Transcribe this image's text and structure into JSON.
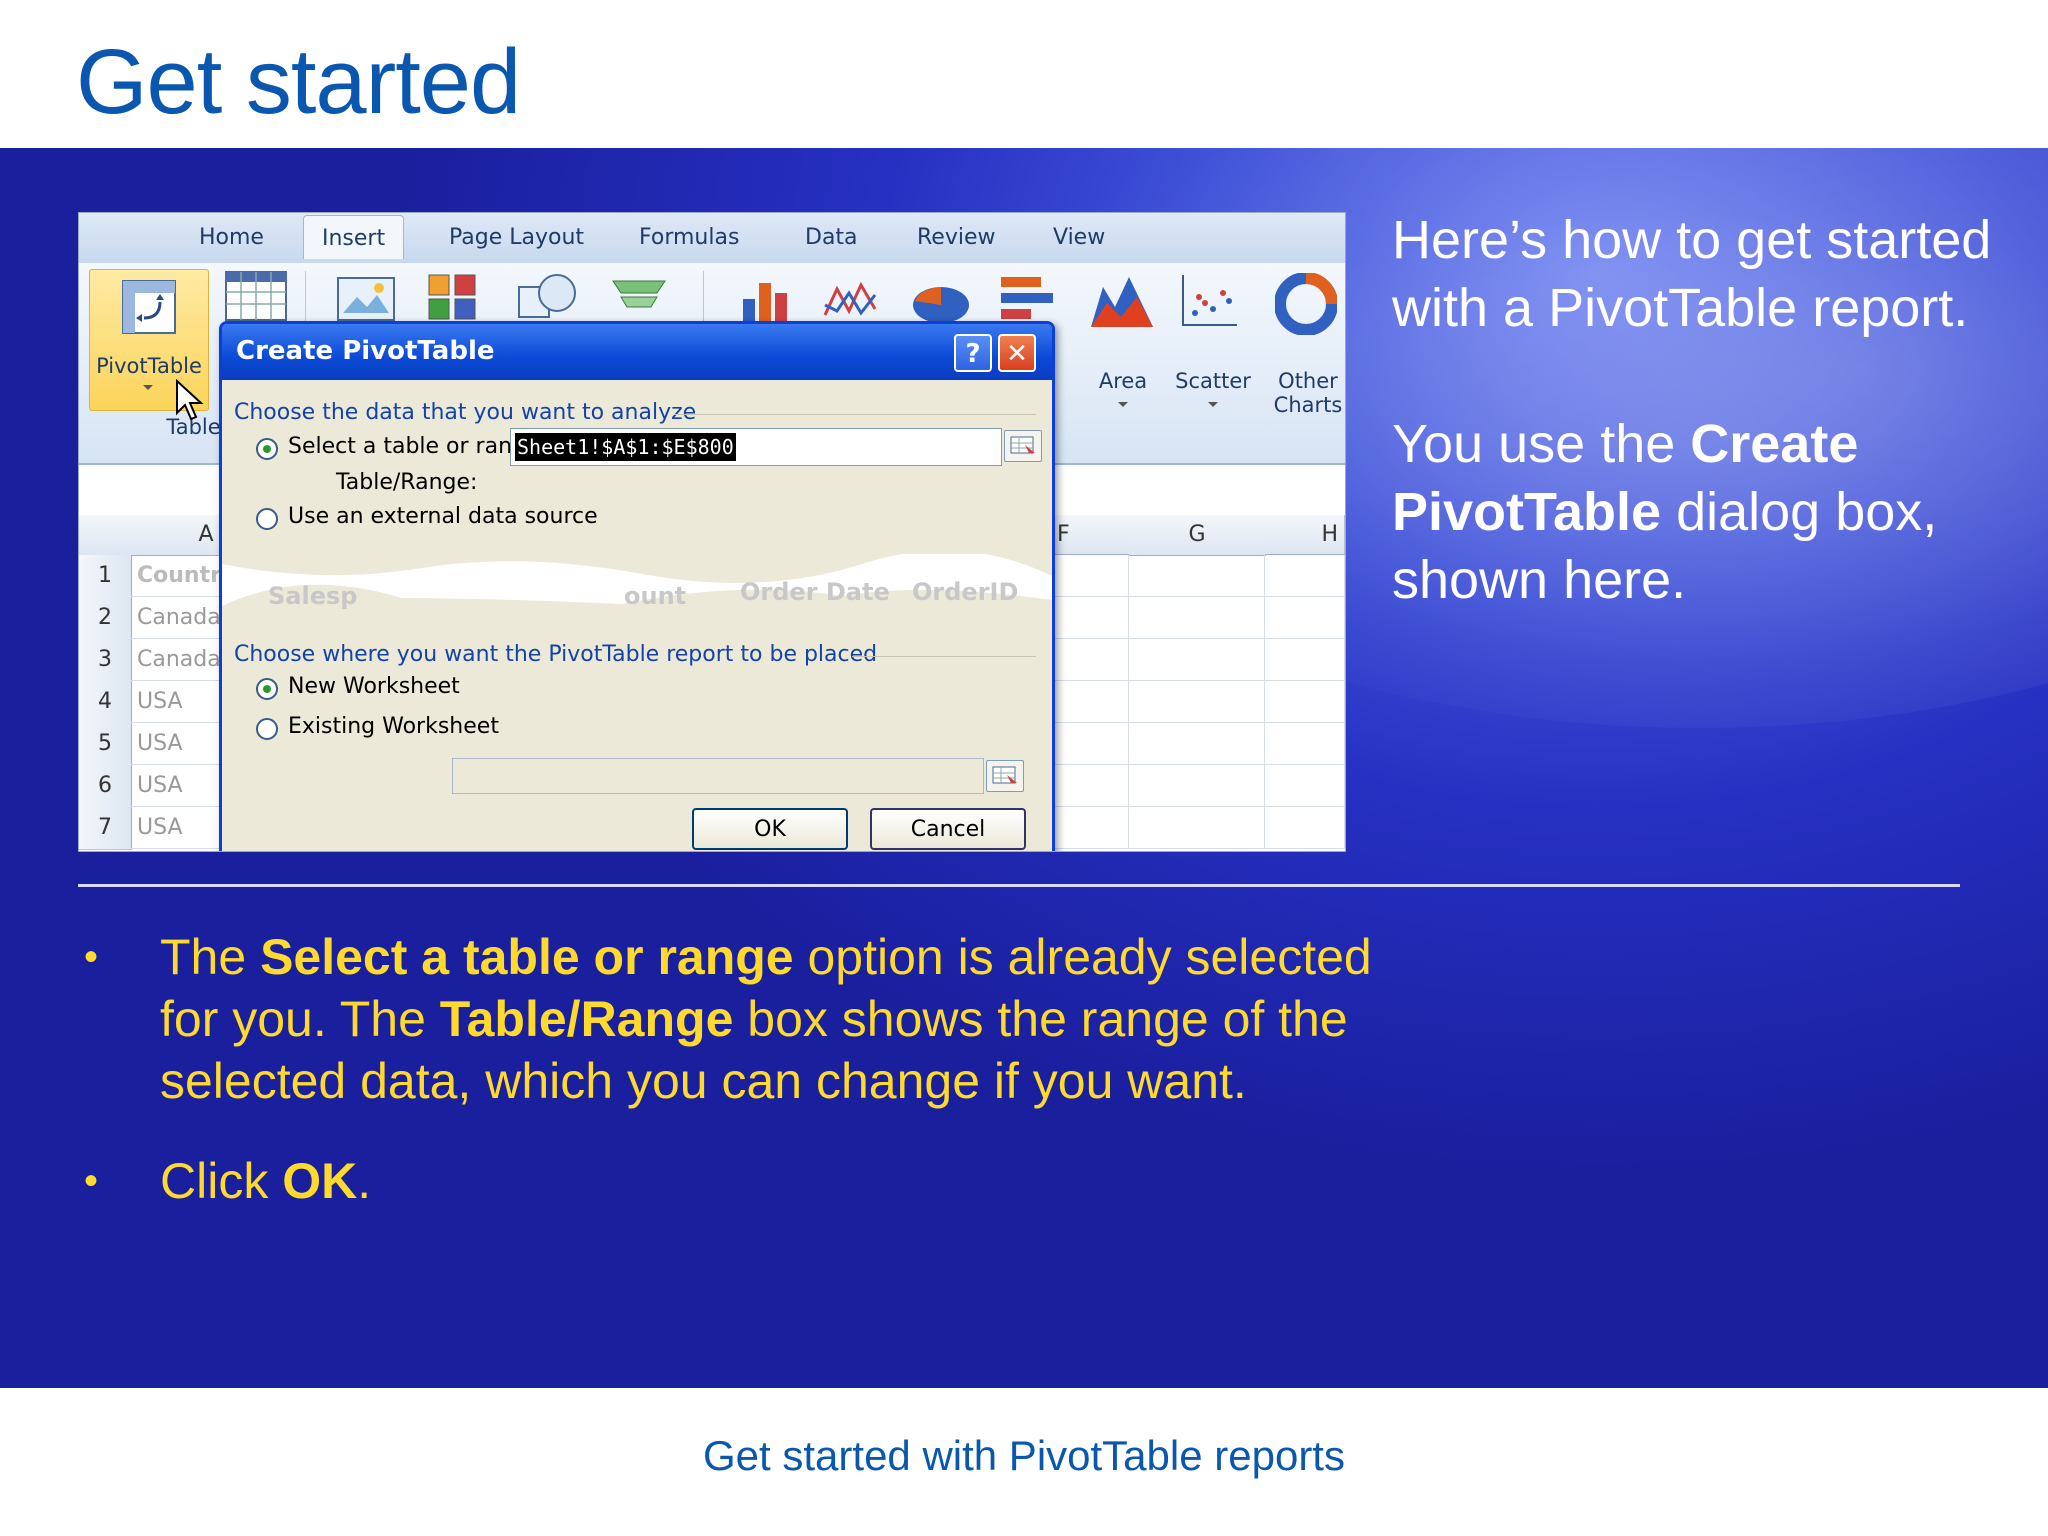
{
  "slide": {
    "title": "Get started",
    "footer": "Get started with PivotTable reports"
  },
  "ribbon": {
    "tabs": [
      "Home",
      "Insert",
      "Page Layout",
      "Formulas",
      "Data",
      "Review",
      "View"
    ],
    "active_tab": "Insert",
    "pivottable_label": "PivotTable",
    "tables_group_label": "Tables",
    "chart_buttons": [
      "Area",
      "Scatter",
      "Other Charts"
    ],
    "other_charts_line1": "Other",
    "other_charts_line2": "Charts",
    "charts_group_fragment": "s",
    "partial_label": "r"
  },
  "sheet": {
    "columns": [
      "A",
      "F",
      "G",
      "H"
    ],
    "rows": [
      "1",
      "2",
      "3",
      "4",
      "5",
      "6",
      "7"
    ],
    "col_a_values": [
      "Country",
      "Canada",
      "Canada",
      "USA",
      "USA",
      "USA",
      "USA"
    ],
    "header_fragments": [
      "Salesp",
      "ount",
      "Order Date",
      "OrderID"
    ]
  },
  "dialog": {
    "title": "Create PivotTable",
    "help_glyph": "?",
    "close_glyph": "✕",
    "section1": "Choose the data that you want to analyze",
    "option_table": "Select a table or range",
    "range_label": "Table/Range:",
    "range_value": "Sheet1!$A$1:$E$800",
    "option_external": "Use an external data source",
    "section2": "Choose where you want the PivotTable report to be placed",
    "option_new": "New Worksheet",
    "option_existing": "Existing Worksheet",
    "ok_label": "OK",
    "cancel_label": "Cancel"
  },
  "right_text": {
    "para1": "Here’s how to get started with a PivotTable report.",
    "para2_a": "You use the ",
    "para2_bold": "Create PivotTable",
    "para2_b": " dialog box, shown here."
  },
  "bullets": {
    "b1_a": "The ",
    "b1_bold1": "Select a table or range",
    "b1_b": " option is already selected for you. The ",
    "b1_bold2": "Table/Range",
    "b1_c": " box shows the range of the selected data, which you can change if you want.",
    "b2_a": "Click ",
    "b2_bold": "OK",
    "b2_b": "."
  },
  "colors": {
    "title_blue": "#0a57b0",
    "bullet_yellow": "#ffd92c",
    "band_blue": "#2630c2"
  }
}
